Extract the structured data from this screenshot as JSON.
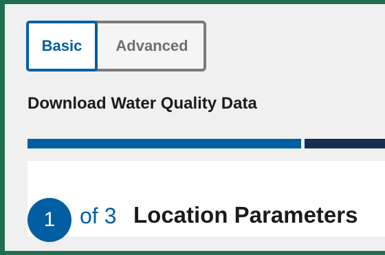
{
  "tabs": {
    "basic_label": "Basic",
    "advanced_label": "Advanced",
    "selected": "Basic"
  },
  "page_title": "Download Water Quality Data",
  "step_indicator": {
    "current": "1",
    "total_label": "of 3",
    "heading": "Location Parameters"
  },
  "colors": {
    "frame_border": "#1f6f4f",
    "accent": "#005ea2",
    "dark": "#162e51",
    "tab_border": "#7a7a7a"
  }
}
